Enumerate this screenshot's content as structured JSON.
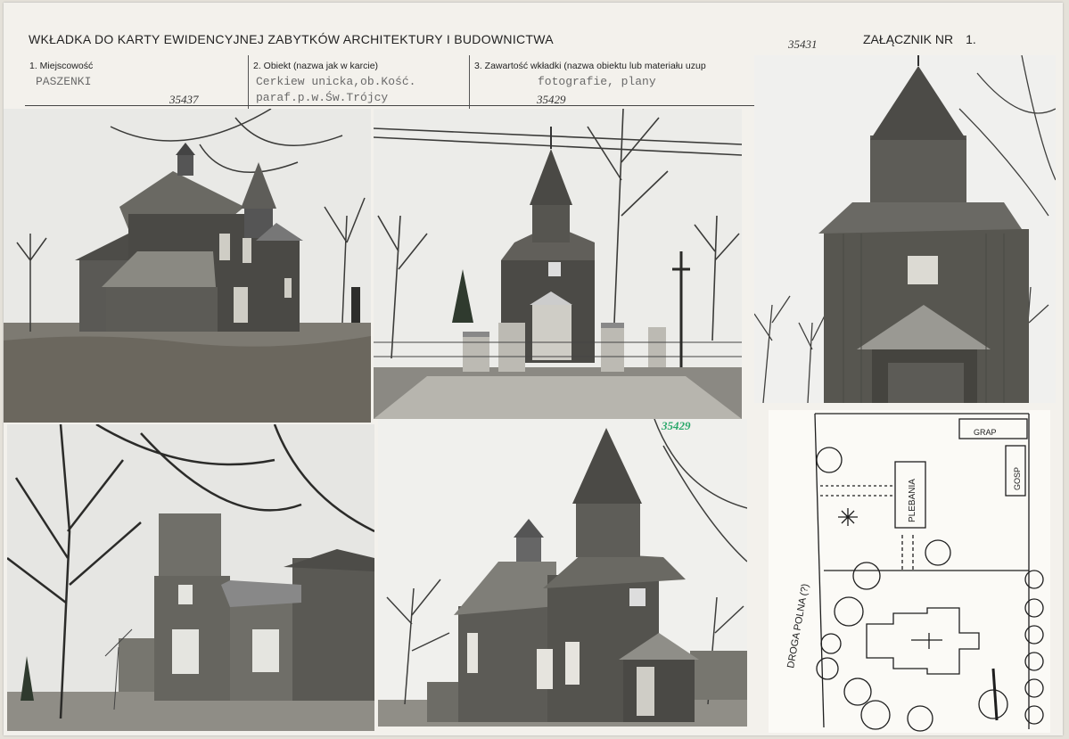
{
  "header": {
    "title": "WKŁADKA DO KARTY EWIDENCYJNEJ ZABYTKÓW ARCHITEKTURY I BUDOWNICTWA",
    "annex_label": "ZAŁĄCZNIK NR",
    "annex_number": "1."
  },
  "handwritten": {
    "top_number": "35431",
    "field1_number": "35437",
    "field3_number": "35429",
    "photo_number": "35429"
  },
  "fields": [
    {
      "label": "1. Miejscowość",
      "value": "PASZENKI"
    },
    {
      "label": "2. Obiekt (nazwa jak w karcie)",
      "value_line1": "Cerkiew unicka,ob.Kość.",
      "value_line2": "paraf.p.w.Św.Trójcy"
    },
    {
      "label": "3. Zawartość wkładki (nazwa obiektu lub materiału uzup",
      "value": "fotografie, plany"
    }
  ],
  "plan": {
    "labels": {
      "road": "DROGA POLNA (?)",
      "shed": "GRAP",
      "plebania": "PLEBANIA",
      "gosp": "GOSP"
    }
  }
}
